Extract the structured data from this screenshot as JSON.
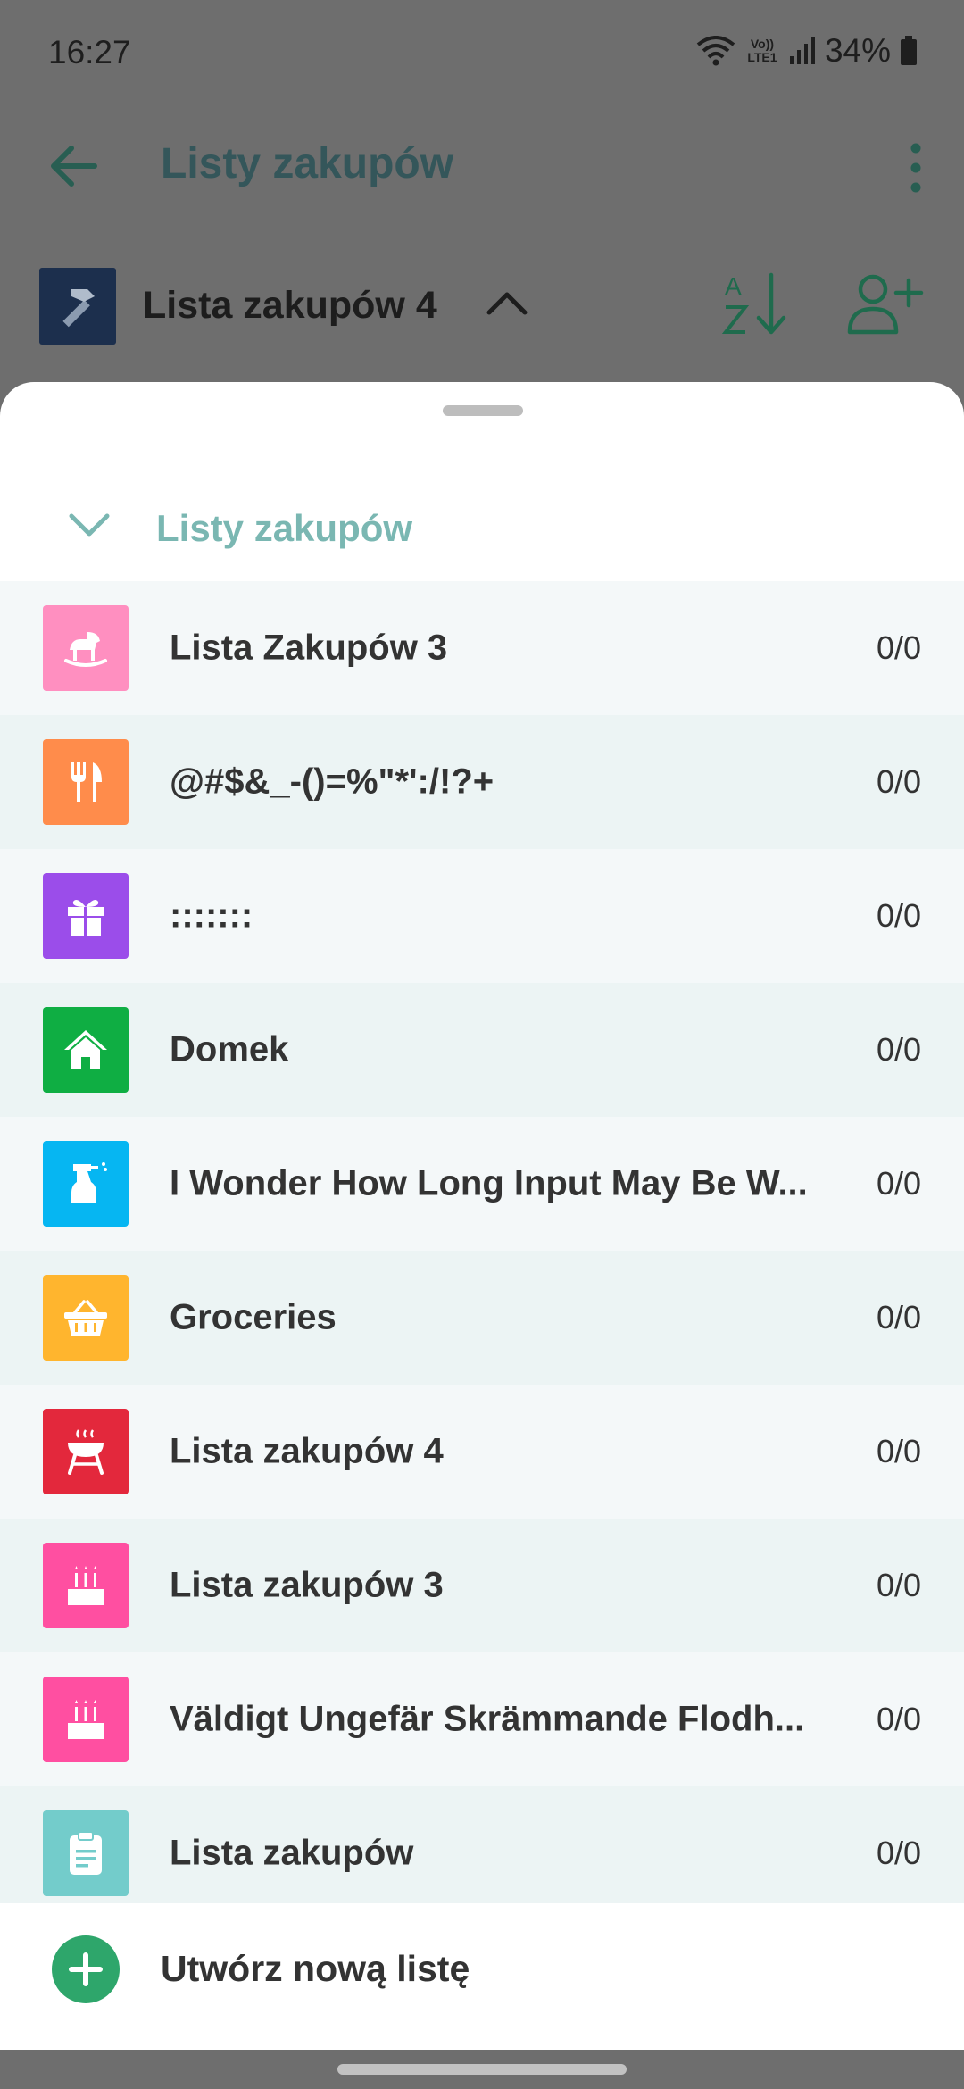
{
  "status_bar": {
    "time": "16:27",
    "network_label": "Vo)) LTE1",
    "battery": "34%"
  },
  "app_bar": {
    "title": "Listy zakupów",
    "back_icon": "arrow-left-icon",
    "menu_icon": "more-vertical-icon"
  },
  "current_list": {
    "name": "Lista zakupów 4",
    "icon": "hammer-icon",
    "icon_color": "#1c2f4d",
    "sort_icon": "sort-alpha-icon",
    "share_icon": "add-person-icon"
  },
  "sheet": {
    "title": "Listy zakupów",
    "collapse_icon": "chevron-down-icon",
    "items": [
      {
        "label": "Lista Zakupów 3",
        "count": "0/0",
        "icon": "rocking-horse-icon",
        "color": "#ff8fc0"
      },
      {
        "label": "@#$&_-()=%\"*':/!?+",
        "count": "0/0",
        "icon": "cutlery-icon",
        "color": "#ff8c4b"
      },
      {
        "label": ":::::::",
        "count": "0/0",
        "icon": "gift-icon",
        "color": "#9b4dea"
      },
      {
        "label": "Domek",
        "count": "0/0",
        "icon": "house-icon",
        "color": "#0fae43"
      },
      {
        "label": "I Wonder How Long Input May Be W...",
        "count": "0/0",
        "icon": "spray-bottle-icon",
        "color": "#06b6f2"
      },
      {
        "label": "Groceries",
        "count": "0/0",
        "icon": "basket-icon",
        "color": "#ffb52e"
      },
      {
        "label": "Lista zakupów 4",
        "count": "0/0",
        "icon": "grill-icon",
        "color": "#e3283c"
      },
      {
        "label": "Lista zakupów 3",
        "count": "0/0",
        "icon": "cake-icon",
        "color": "#ff4fa1"
      },
      {
        "label": "Väldigt Ungefär Skrämmande Flodh...",
        "count": "0/0",
        "icon": "cake-icon",
        "color": "#ff4fa1"
      },
      {
        "label": "Lista zakupów",
        "count": "0/0",
        "icon": "clipboard-icon",
        "color": "#73cccb"
      }
    ],
    "add_label": "Utwórz nową listę",
    "add_icon": "plus-icon",
    "add_color": "#2ea66b"
  }
}
